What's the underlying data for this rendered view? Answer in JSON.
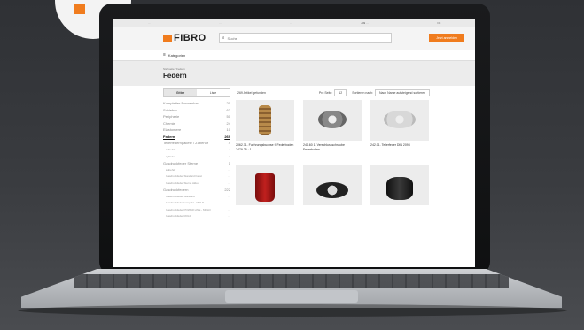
{
  "colors": {
    "brand": "#f07c1e"
  },
  "topbar": {
    "items": [
      "…",
      "…",
      "…"
    ],
    "phone": "+49 …",
    "lang": "DE"
  },
  "header": {
    "logo": "FIBRO",
    "search_placeholder": "Suche",
    "cta": "Jetzt anmelden"
  },
  "nav": {
    "categories": "Kategorien"
  },
  "page": {
    "breadcrumb": "Startseite / Federn",
    "title": "Federn"
  },
  "toolbar": {
    "view_grid": "Gitter",
    "view_list": "Liste",
    "count": "269 Artikel gefunden",
    "per_page_label": "Pro Seite:",
    "per_page_value": "12",
    "sort_label": "Sortieren nach:",
    "sort_value": "Nach Name aufsteigend sortieren"
  },
  "sidebar": {
    "items": [
      {
        "label": "Kompletter Formenbau",
        "count": "20",
        "level": "top"
      },
      {
        "label": "Schieber",
        "count": "63",
        "level": "top"
      },
      {
        "label": "Peripherie",
        "count": "50",
        "level": "top"
      },
      {
        "label": "Chemie",
        "count": "24",
        "level": "top"
      },
      {
        "label": "Elastomere",
        "count": "10",
        "level": "top"
      },
      {
        "label": "Federn",
        "count": "269",
        "level": "active"
      },
      {
        "label": "Tellerfedernpakete / Zubehör",
        "count": "4",
        "level": "top"
      },
      {
        "label": "Zubehör",
        "count": "1",
        "level": "sub"
      },
      {
        "label": "Zylinder",
        "count": "3",
        "level": "sub"
      },
      {
        "label": "Gasdruckfeder Sterne",
        "count": "1",
        "level": "top"
      },
      {
        "label": "Zubehör",
        "count": "…",
        "level": "sub"
      },
      {
        "label": "Gasdruckfeder Standard Fasst",
        "count": "…",
        "level": "sub"
      },
      {
        "label": "Gasdruckfeder Sterne Akku",
        "count": "…",
        "level": "sub"
      },
      {
        "label": "Gasdruckfedern",
        "count": "222",
        "level": "top"
      },
      {
        "label": "Gasdruckfeder Standard",
        "count": "…",
        "level": "sub"
      },
      {
        "label": "Gasdruckfeder kompakt - MOLD",
        "count": "…",
        "level": "sub"
      },
      {
        "label": "Gasdruckfeder POWER LINE - MOLD",
        "count": "…",
        "level": "sub"
      },
      {
        "label": "Gasdruckfeder ROLD",
        "count": "…",
        "level": "sub"
      }
    ]
  },
  "products": [
    {
      "caption": "2062.71. Fuehrungsbuchse f. Federboden 2479.25 : 1",
      "img": "p1"
    },
    {
      "caption": "241.60 1. Verschlussschraube Federboden",
      "img": "p2"
    },
    {
      "caption": "242.01. Tellerfeder DIN 2093",
      "img": "p3"
    },
    {
      "caption": "",
      "img": "p4"
    },
    {
      "caption": "",
      "img": "p5"
    },
    {
      "caption": "",
      "img": "p6"
    }
  ]
}
